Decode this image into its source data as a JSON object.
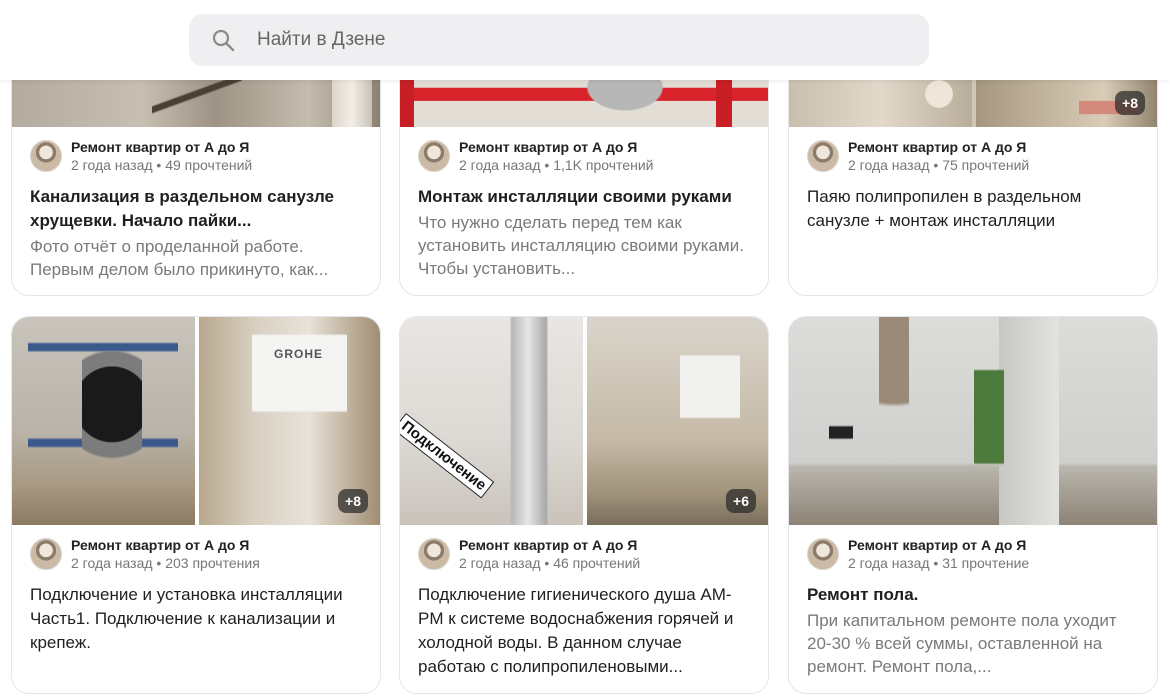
{
  "search": {
    "placeholder": "Найти в Дзене"
  },
  "colors": {
    "search_bg": "#efeff2",
    "border": "#e4e5e8",
    "badge_bg": "#3a3a3a"
  },
  "cards": [
    {
      "channel": "Ремонт квартир от А до Я",
      "stats": "2 года назад • 49 прочтений",
      "title": "Канализация в раздельном санузле хрущевки. Начало пайки...",
      "snippet": "Фото отчёт о проделанной работе. Первым делом было прикинуто, как...",
      "badge": ""
    },
    {
      "channel": "Ремонт квартир от А до Я",
      "stats": "2 года назад • 1,1K прочтений",
      "title": "Монтаж инсталляции своими руками",
      "snippet": "Что нужно сделать перед тем как установить инсталляцию своими руками. Чтобы установить...",
      "badge": ""
    },
    {
      "channel": "Ремонт квартир от А до Я",
      "stats": "2 года назад • 75 прочтений",
      "title": "Паяю полипропилен в раздельном санузле + монтаж инсталляции",
      "snippet": "",
      "badge": "+8"
    },
    {
      "channel": "Ремонт квартир от А до Я",
      "stats": "2 года назад • 203 прочтения",
      "title": "Подключение и установка инсталляции Часть1. Подключение к канализации и крепеж.",
      "snippet": "",
      "badge": "+8",
      "image_text": "GROHE"
    },
    {
      "channel": "Ремонт квартир от А до Я",
      "stats": "2 года назад • 46 прочтений",
      "title": "Подключение гигиенического душа AM-PM к системе водоснабжения горячей и холодной воды. В данном случае работаю с полипропиленовыми...",
      "snippet": "",
      "badge": "+6",
      "image_text": "Подключение"
    },
    {
      "channel": "Ремонт квартир от А до Я",
      "stats": "2 года назад • 31 прочтение",
      "title": "Ремонт пола.",
      "snippet": "При капитальном ремонте  пола уходит  20-30 % всей суммы, оставленной на ремонт. Ремонт пола,...",
      "badge": ""
    }
  ]
}
